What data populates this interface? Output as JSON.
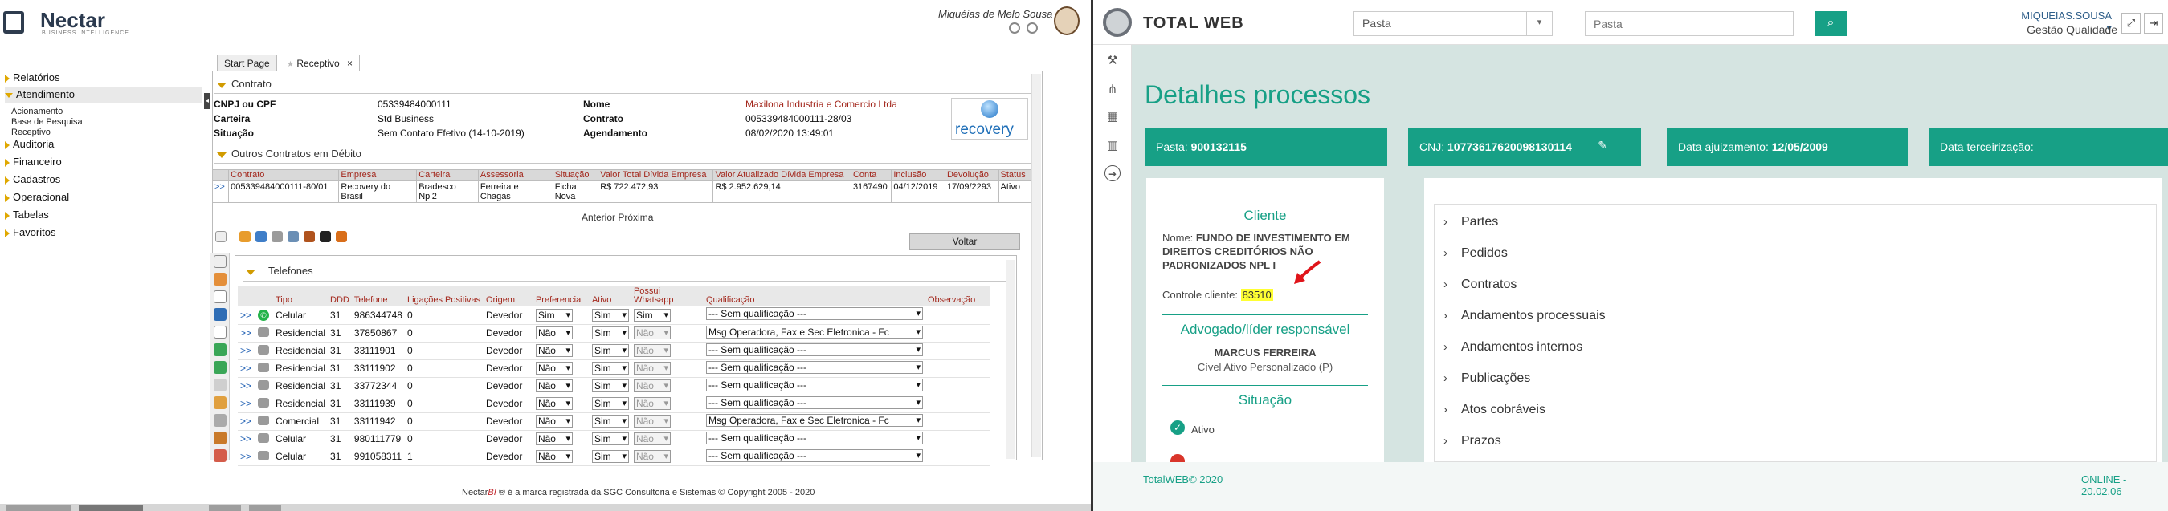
{
  "nectar": {
    "logo": {
      "name": "Nectar",
      "sub": "BUSINESS INTELLIGENCE"
    },
    "user": "Miquéias de Melo Sousa",
    "nav": [
      {
        "label": "Relatórios"
      },
      {
        "label": "Atendimento"
      },
      {
        "label": "Auditoria"
      },
      {
        "label": "Financeiro"
      },
      {
        "label": "Cadastros"
      },
      {
        "label": "Operacional"
      },
      {
        "label": "Tabelas"
      },
      {
        "label": "Favoritos"
      }
    ],
    "nav_sub": [
      "Acionamento",
      "Base de Pesquisa",
      "Receptivo"
    ],
    "tabs": {
      "start": "Start Page",
      "receptivo": "Receptivo",
      "close": "×"
    },
    "contrato": {
      "title": "Contrato",
      "cnpj_label": "CNPJ ou CPF",
      "cnpj_value": "05339484000111",
      "nome_label": "Nome",
      "nome_value": "Maxilona Industria e Comercio Ltda",
      "carteira_label": "Carteira",
      "carteira_value": "Std Business",
      "contrato_label": "Contrato",
      "contrato_value": "005339484000111-28/03",
      "situacao_label": "Situação",
      "situacao_value": "Sem Contato Efetivo (14-10-2019)",
      "agend_label": "Agendamento",
      "agend_value": "08/02/2020 13:49:01",
      "badge": "recovery"
    },
    "outros": {
      "title": "Outros Contratos em Débito",
      "headers": [
        "",
        "Contrato",
        "Empresa",
        "Carteira",
        "Assessoria",
        "Situação",
        "Valor Total Dívida Empresa",
        "Valor Atualizado Dívida Empresa",
        "Conta",
        "Inclusão",
        "Devolução",
        "Status"
      ],
      "row": [
        ">>",
        "005339484000111-80/01",
        "Recovery do Brasil",
        "Bradesco Npl2",
        "Ferreira e Chagas",
        "Ficha Nova",
        "R$ 722.472,93",
        "R$ 2.952.629,14",
        "3167490",
        "04/12/2019",
        "17/09/2293",
        "Ativo"
      ],
      "pager": "Anterior Próxima"
    },
    "voltar": "Voltar",
    "telefones": {
      "title": "Telefones",
      "headers": [
        "",
        "",
        "Tipo",
        "DDD",
        "Telefone",
        "Ligações Positivas",
        "Origem",
        "Preferencial",
        "Ativo",
        "Possui Whatsapp",
        "Qualificação",
        "Observação"
      ],
      "rows": [
        {
          "go": ">>",
          "tipo": "Celular",
          "ddd": "31",
          "tel": "986344748",
          "lig": "0",
          "origem": "Devedor",
          "pref": "Sim",
          "ativo": "Sim",
          "wa": "Sim",
          "qual": "--- Sem qualificação ---"
        },
        {
          "go": ">>",
          "tipo": "Residencial",
          "ddd": "31",
          "tel": "37850867",
          "lig": "0",
          "origem": "Devedor",
          "pref": "Não",
          "ativo": "Sim",
          "wa": "Não",
          "qual": "Msg Operadora, Fax e Sec Eletronica - Fc"
        },
        {
          "go": ">>",
          "tipo": "Residencial",
          "ddd": "31",
          "tel": "33111901",
          "lig": "0",
          "origem": "Devedor",
          "pref": "Não",
          "ativo": "Sim",
          "wa": "Não",
          "qual": "--- Sem qualificação ---"
        },
        {
          "go": ">>",
          "tipo": "Residencial",
          "ddd": "31",
          "tel": "33111902",
          "lig": "0",
          "origem": "Devedor",
          "pref": "Não",
          "ativo": "Sim",
          "wa": "Não",
          "qual": "--- Sem qualificação ---"
        },
        {
          "go": ">>",
          "tipo": "Residencial",
          "ddd": "31",
          "tel": "33772344",
          "lig": "0",
          "origem": "Devedor",
          "pref": "Não",
          "ativo": "Sim",
          "wa": "Não",
          "qual": "--- Sem qualificação ---"
        },
        {
          "go": ">>",
          "tipo": "Residencial",
          "ddd": "31",
          "tel": "33111939",
          "lig": "0",
          "origem": "Devedor",
          "pref": "Não",
          "ativo": "Sim",
          "wa": "Não",
          "qual": "--- Sem qualificação ---"
        },
        {
          "go": ">>",
          "tipo": "Comercial",
          "ddd": "31",
          "tel": "33111942",
          "lig": "0",
          "origem": "Devedor",
          "pref": "Não",
          "ativo": "Sim",
          "wa": "Não",
          "qual": "Msg Operadora, Fax e Sec Eletronica - Fc"
        },
        {
          "go": ">>",
          "tipo": "Celular",
          "ddd": "31",
          "tel": "980111779",
          "lig": "0",
          "origem": "Devedor",
          "pref": "Não",
          "ativo": "Sim",
          "wa": "Não",
          "qual": "--- Sem qualificação ---"
        },
        {
          "go": ">>",
          "tipo": "Celular",
          "ddd": "31",
          "tel": "991058311",
          "lig": "1",
          "origem": "Devedor",
          "pref": "Não",
          "ativo": "Sim",
          "wa": "Não",
          "qual": "--- Sem qualificação ---"
        }
      ]
    },
    "footer": {
      "brand": "Nectar",
      "brand_bi": "BI",
      "text": " ® é a marca registrada da SGC Consultoria e Sistemas © Copyright 2005 - 2020"
    }
  },
  "totalweb": {
    "brand": "TOTAL WEB",
    "pasta_select": "Pasta",
    "search_placeholder": "Pasta",
    "user": "MIQUEIAS.SOUSA ▾",
    "role": "Gestão Qualidade",
    "title": "Detalhes processos",
    "cards": [
      {
        "label": "Pasta:",
        "value": "900132115"
      },
      {
        "label": "CNJ:",
        "value": "10773617620098130114"
      },
      {
        "label": "Data ajuizamento:",
        "value": "12/05/2009"
      },
      {
        "label": "Data terceirização:",
        "value": ""
      }
    ],
    "cliente": {
      "head": "Cliente",
      "nome_label": "Nome:",
      "nome_value": "FUNDO DE INVESTIMENTO EM DIREITOS CREDITÓRIOS NÃO PADRONIZADOS NPL I",
      "controle_label": "Controle cliente:",
      "controle_value": "83510",
      "adv_head": "Advogado/líder responsável",
      "adv_name": "MARCUS FERREIRA",
      "adv_dept": "Cível Ativo Personalizado (P)",
      "sit_head": "Situação",
      "sit_value": "Ativo"
    },
    "sections": [
      "Partes",
      "Pedidos",
      "Contratos",
      "Andamentos processuais",
      "Andamentos internos",
      "Publicações",
      "Atos cobráveis",
      "Prazos"
    ],
    "footer_left": "TotalWEB© 2020",
    "footer_right": "ONLINE - 20.02.06"
  },
  "colors": {
    "teal": "#17a086",
    "nectar_red": "#a3271c",
    "accent_yellow": "#d19b00"
  }
}
